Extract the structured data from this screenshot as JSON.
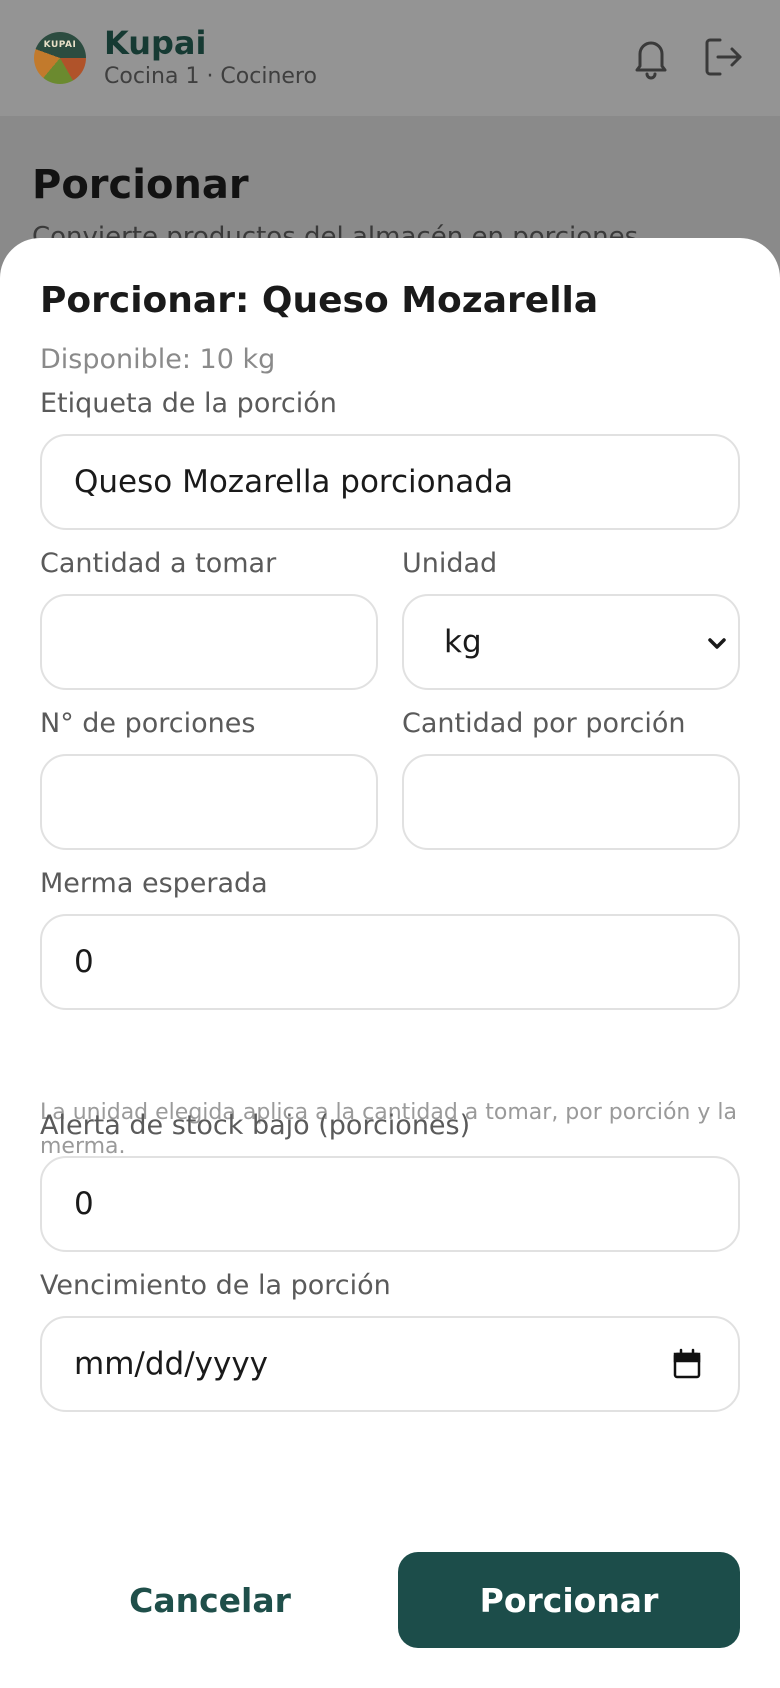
{
  "app": {
    "name": "Kupai",
    "subtitle": "Cocina 1 · Cocinero",
    "logo_text": "KUPAI",
    "icons": [
      "bell-icon",
      "logout-icon"
    ]
  },
  "page": {
    "title": "Porcionar",
    "description": "Convierte productos del almacén en porciones"
  },
  "modal": {
    "title": "Porcionar: Queso Mozarella",
    "available": "Disponible: 10 kg",
    "fields": {
      "label_name": {
        "label": "Etiqueta de la porción",
        "value": "Queso Mozarella porcionada"
      },
      "quantity": {
        "label": "Cantidad a tomar",
        "value": ""
      },
      "unit": {
        "label": "Unidad",
        "value": "kg"
      },
      "portions": {
        "label": "N° de porciones",
        "value": ""
      },
      "per_portion": {
        "label": "Cantidad por porción",
        "value": ""
      },
      "waste": {
        "label": "Merma esperada",
        "value": "0"
      },
      "low_stock": {
        "label": "Alerta de stock bajo (porciones)",
        "value": "0"
      },
      "expiry": {
        "label": "Vencimiento de la porción",
        "placeholder": "mm/dd/yyyy"
      }
    },
    "hint": "La unidad elegida aplica a la cantidad a tomar, por porción y la merma.",
    "buttons": {
      "cancel": "Cancelar",
      "submit": "Porcionar"
    }
  },
  "colors": {
    "accent": "#1c4d4a",
    "brand_text": "#163a33",
    "overlay": "#8e8e8e"
  }
}
